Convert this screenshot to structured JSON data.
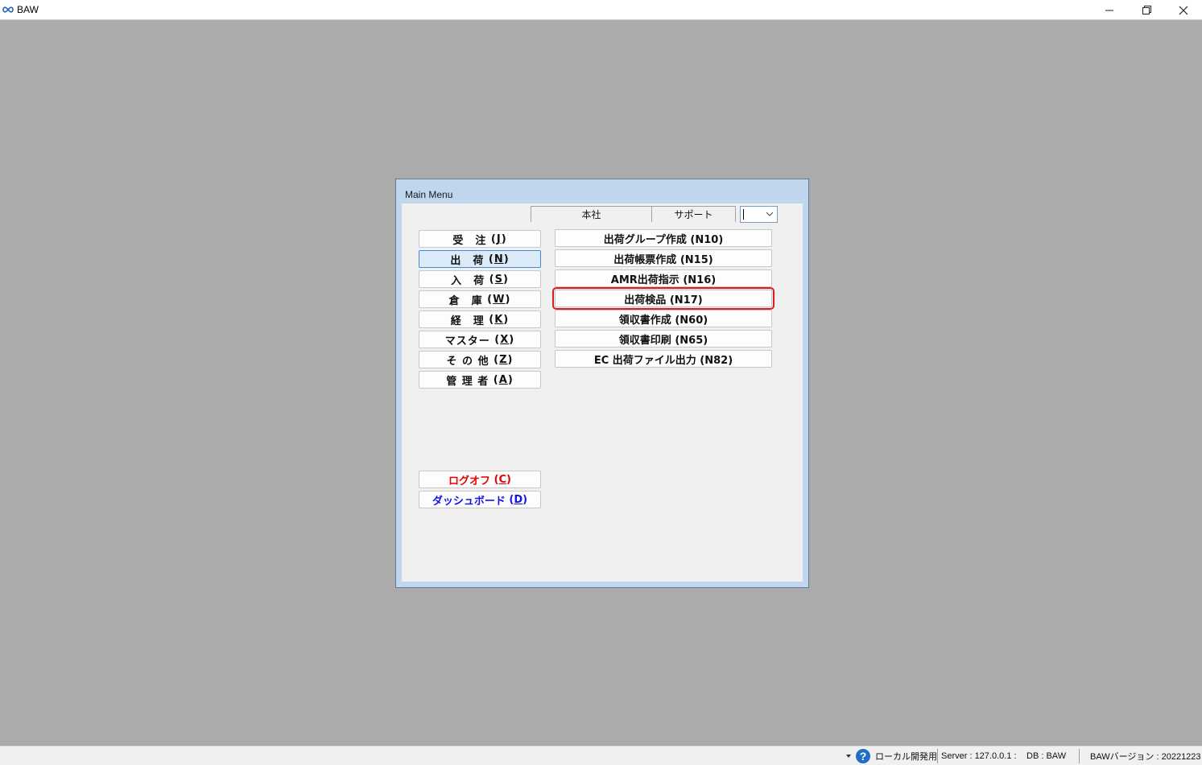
{
  "window": {
    "title": "BAW"
  },
  "dialog": {
    "title": "Main Menu",
    "tabs": [
      {
        "label": "本社"
      },
      {
        "label": "サポート"
      }
    ],
    "combo": {
      "value": ""
    },
    "left_menu": [
      {
        "label": "受　注",
        "key": "J",
        "selected": false
      },
      {
        "label": "出　荷",
        "key": "N",
        "selected": true
      },
      {
        "label": "入　荷",
        "key": "S",
        "selected": false
      },
      {
        "label": "倉　庫",
        "key": "W",
        "selected": false
      },
      {
        "label": "経　理",
        "key": "K",
        "selected": false
      },
      {
        "label": "マスター",
        "key": "X",
        "selected": false
      },
      {
        "label": "そ の 他",
        "key": "Z",
        "selected": false
      },
      {
        "label": "管 理 者",
        "key": "A",
        "selected": false
      }
    ],
    "right_menu": [
      {
        "label": "出荷グループ作成 (N10)",
        "highlighted": false
      },
      {
        "label": "出荷帳票作成 (N15)",
        "highlighted": false
      },
      {
        "label": "AMR出荷指示 (N16)",
        "highlighted": false
      },
      {
        "label": "出荷検品 (N17)",
        "highlighted": true
      },
      {
        "label": "領収書作成 (N60)",
        "highlighted": false
      },
      {
        "label": "領収書印刷 (N65)",
        "highlighted": false
      },
      {
        "label": "EC 出荷ファイル出力 (N82)",
        "highlighted": false
      }
    ],
    "logoff": {
      "label": "ログオフ",
      "key": "C"
    },
    "dashboard": {
      "label": "ダッシュボード",
      "key": "D"
    }
  },
  "statusbar": {
    "env": "ローカル開発用",
    "server": "Server : 127.0.0.1 :",
    "db": "DB : BAW",
    "version": "BAWバージョン : 20221223"
  },
  "colors": {
    "highlight": "#e11b1b",
    "logoff": "#e60000",
    "dashboard": "#1212ee",
    "selected": "#3d8ad8"
  }
}
